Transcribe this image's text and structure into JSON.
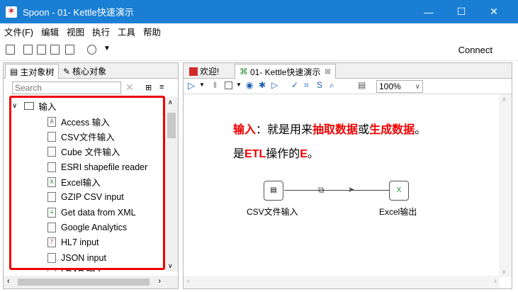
{
  "window": {
    "title": "Spoon - 01- Kettle快速演示",
    "minimize": "—",
    "maximize": "☐",
    "close": "✕"
  },
  "menu": [
    "文件(F)",
    "编辑",
    "视图",
    "执行",
    "工具",
    "帮助"
  ],
  "toolbar": {
    "connect_label": "Connect"
  },
  "left_panel": {
    "tabs": [
      "主对象树",
      "核心对象"
    ],
    "search_placeholder": "Search",
    "tree_root": "输入",
    "tree_items": [
      "Access 输入",
      "CSV文件输入",
      "Cube 文件输入",
      "ESRI shapefile reader",
      "Excel输入",
      "GZIP CSV input",
      "Get data from XML",
      "Google Analytics",
      "HL7 input",
      "JSON input",
      "LDAP 输入"
    ]
  },
  "right_panel": {
    "tabs": [
      "欢迎!",
      "01- Kettle快速演示"
    ],
    "zoom": "100%",
    "note_line1": {
      "p1": "输入",
      "p2": "：就是用来",
      "p3": "抽取数据",
      "p4": "或",
      "p5": "生成数据",
      "p6": "。"
    },
    "note_line2": {
      "p1": "是",
      "p2": "ETL",
      "p3": "操作的",
      "p4": "E",
      "p5": "。"
    },
    "step1_label": "CSV文件输入",
    "step2_label": "Excel输出"
  },
  "colors": {
    "titlebar": "#1a7fd4",
    "highlight": "#ee0000"
  },
  "icons": [
    "spoon-app-icon",
    "new-file-icon",
    "open-icon",
    "save-icon",
    "run-icon",
    "pause-icon",
    "stop-icon",
    "folder-icon",
    "step-icon"
  ]
}
